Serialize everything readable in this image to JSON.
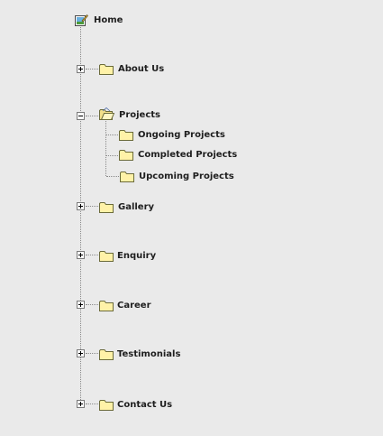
{
  "tree": {
    "root": {
      "label": "Home",
      "icon": "home-page-icon"
    },
    "items": [
      {
        "label": "About Us",
        "icon": "folder-icon",
        "state": "collapsed"
      },
      {
        "label": "Projects",
        "icon": "folder-open-icon",
        "state": "expanded",
        "children": [
          {
            "label": "Ongoing Projects",
            "icon": "folder-icon"
          },
          {
            "label": "Completed Projects",
            "icon": "folder-icon"
          },
          {
            "label": "Upcoming Projects",
            "icon": "folder-icon"
          }
        ]
      },
      {
        "label": "Gallery",
        "icon": "folder-icon",
        "state": "collapsed"
      },
      {
        "label": "Enquiry",
        "icon": "folder-icon",
        "state": "collapsed"
      },
      {
        "label": "Career",
        "icon": "folder-icon",
        "state": "collapsed"
      },
      {
        "label": "Testimonials",
        "icon": "folder-icon",
        "state": "collapsed"
      },
      {
        "label": "Contact Us",
        "icon": "folder-icon",
        "state": "collapsed"
      }
    ]
  },
  "colors": {
    "background": "#eaeaea",
    "folder_fill": "#fff2a8",
    "folder_stroke": "#6b6b3a",
    "tree_line": "#8a8a8a",
    "text": "#1e1e1e"
  }
}
